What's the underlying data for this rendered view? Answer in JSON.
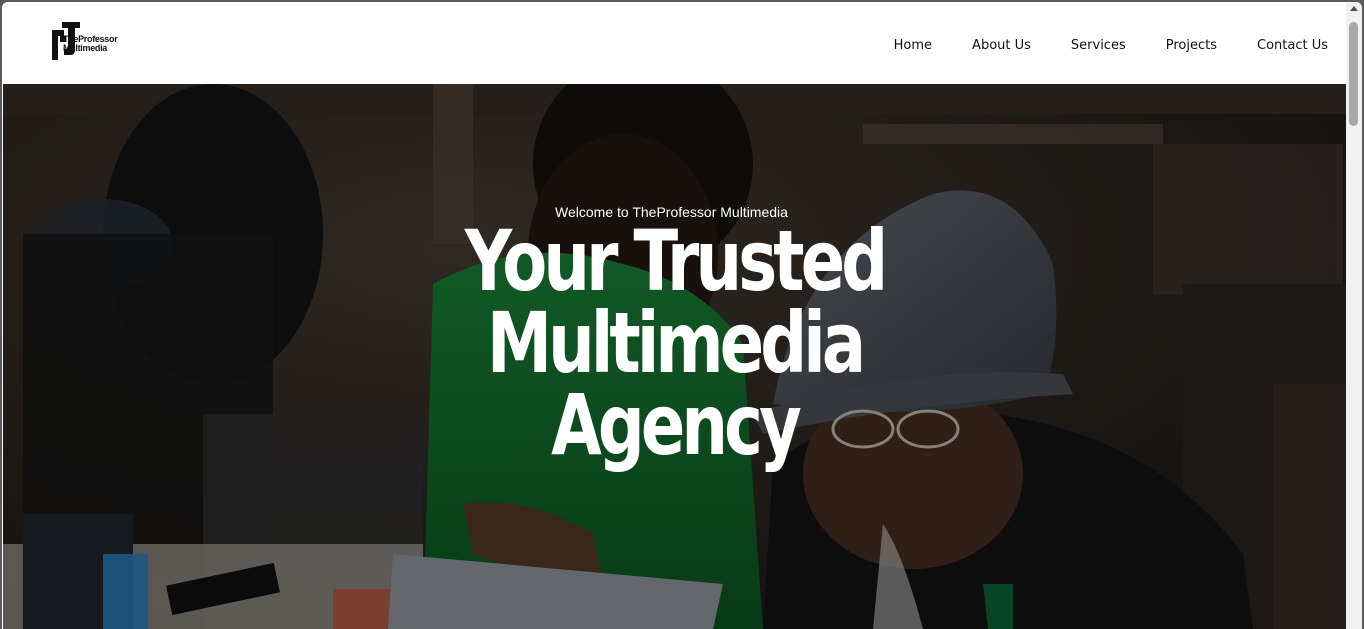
{
  "brand": {
    "logo_line1": "TheProfessor",
    "logo_line2": "Multimedia"
  },
  "nav": {
    "items": [
      "Home",
      "About Us",
      "Services",
      "Projects",
      "Contact Us"
    ]
  },
  "hero": {
    "welcome": "Welcome to TheProfessor Multimedia",
    "headline_line1": "Your Trusted",
    "headline_line2": "Multimedia",
    "headline_line3": "Agency"
  },
  "colors": {
    "nav_bg": "#ffffff",
    "text_dark": "#111111",
    "hero_text": "#ffffff",
    "shirt_green": "#0d7a2c"
  },
  "icons": [
    "logo-mark-icon",
    "scroll-up-icon"
  ]
}
